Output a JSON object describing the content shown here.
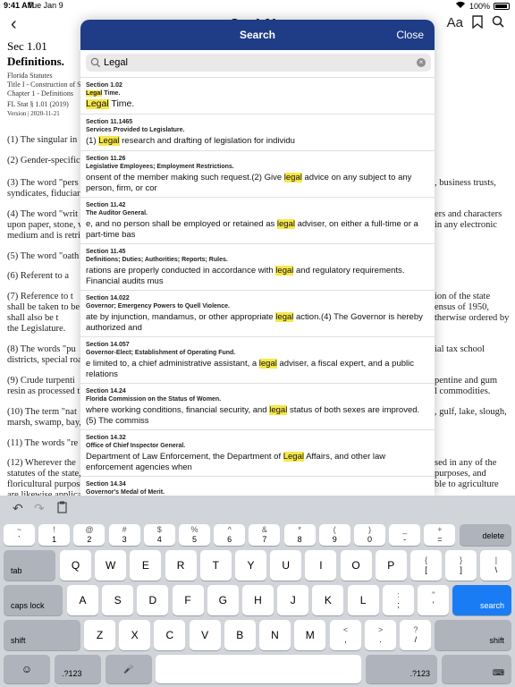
{
  "status": {
    "time": "9:41 AM",
    "date": "Tue Jan 9",
    "battery": "100%"
  },
  "background": {
    "nav_title": "Sec 1.01",
    "section": "Sec 1.01",
    "title": "Definitions.",
    "meta": [
      "Florida Statutes",
      "Title I - Construction of St",
      "Chapter 1 - Definitions",
      "FL Stat § 1.01 (2019)",
      "Version | 2020-11-21"
    ],
    "lines": [
      {
        "l": "(1)   The singular in",
        "r": ""
      },
      {
        "l": "(2)   Gender-specific",
        "r": ""
      },
      {
        "l": "(3)   The word \"pers",
        "r": ", business trusts,"
      },
      {
        "l": "syndicates, fiduciari",
        "r": ""
      },
      {
        "l": "(4)   The word \"writ",
        "r": "ers and characters"
      },
      {
        "l": "upon paper, stone, w",
        "r": "in any electronic"
      },
      {
        "l": "medium and is retrie",
        "r": ""
      },
      {
        "l": "(5)   The word \"oath",
        "r": ""
      },
      {
        "l": "(6)   Referent to a",
        "r": ""
      },
      {
        "l": "(7)   Reference to t",
        "r": "ion of the state"
      },
      {
        "l": "shall be taken to be t",
        "r": "ensus of 1950,"
      },
      {
        "l": "shall also be t",
        "r": "therwise ordered by"
      },
      {
        "l": "the Legislature.",
        "r": ""
      },
      {
        "l": "(8)   The words \"pu",
        "r": "ial tax school"
      },
      {
        "l": "districts, special roa",
        "r": ""
      },
      {
        "l": "(9)   Crude turpenti",
        "r": "pentine and gum"
      },
      {
        "l": "resin as processed th",
        "r": "l commodities."
      },
      {
        "l": "(10)   The term \"nat",
        "r": ", gulf, lake, slough,"
      },
      {
        "l": "marsh, swamp, bay,",
        "r": ""
      },
      {
        "l": "(11)   The words \"re",
        "r": ""
      },
      {
        "l": "(12)   Wherever the",
        "r": "sed in any of the"
      },
      {
        "l": "statutes of the state,",
        "r": "purposes, and"
      },
      {
        "l": "floricultural purpose",
        "r": "ble to agriculture"
      },
      {
        "l": "are likewise applicat",
        "r": ""
      }
    ]
  },
  "search": {
    "title": "Search",
    "close_label": "Close",
    "query": "Legal",
    "results": [
      {
        "section": "Section 1.02",
        "heading_pre": "",
        "heading_hl": "Legal",
        "heading_post": " Time.",
        "pre": "",
        "hl": "Legal",
        "post": " Time."
      },
      {
        "section": "Section 11.1465",
        "heading_pre": "Services Provided to Legislature.",
        "heading_hl": "",
        "heading_post": "",
        "pre": "(1)    ",
        "hl": "Legal",
        "post": " research and drafting of legislation for individu"
      },
      {
        "section": "Section 11.26",
        "heading_pre": "Legislative Employees; Employment Restrictions.",
        "heading_hl": "",
        "heading_post": "",
        "pre": "onsent of the member making such request.(2)    Give ",
        "hl": "legal",
        "post": " advice on any subject to any person, firm, or cor"
      },
      {
        "section": "Section 11.42",
        "heading_pre": "The Auditor General.",
        "heading_hl": "",
        "heading_post": "",
        "pre": "e, and no person shall be employed or retained as ",
        "hl": "legal",
        "post": " adviser, on either a full-time or a part-time bas"
      },
      {
        "section": "Section 11.45",
        "heading_pre": "Definitions; Duties; Authorities; Reports; Rules.",
        "heading_hl": "",
        "heading_post": "",
        "pre": "rations are properly conducted in accordance with ",
        "hl": "legal",
        "post": " and regulatory requirements. Financial audits mus"
      },
      {
        "section": "Section 14.022",
        "heading_pre": "Governor; Emergency Powers to Quell Violence.",
        "heading_hl": "",
        "heading_post": "",
        "pre": "ate by injunction, mandamus, or other appropriate ",
        "hl": "legal",
        "post": " action.(4)    The Governor is hereby authorized and"
      },
      {
        "section": "Section 14.057",
        "heading_pre": "Governor-Elect; Establishment of Operating Fund.",
        "heading_hl": "",
        "heading_post": "",
        "pre": "e limited to, a chief administrative assistant, a ",
        "hl": "legal",
        "post": " adviser, a fiscal expert, and a public relations"
      },
      {
        "section": "Section 14.24",
        "heading_pre": "Florida Commission on the Status of Women.",
        "heading_hl": "",
        "heading_post": "",
        "pre": "where working conditions, financial security, and ",
        "hl": "legal",
        "post": " status of both sexes are improved.(5)    The commiss"
      },
      {
        "section": "Section 14.32",
        "heading_pre": "Office of Chief Inspector General.",
        "heading_hl": "",
        "heading_post": "",
        "pre": " Department of Law Enforcement, the Department of ",
        "hl": "Legal",
        "post": " Affairs, and other law enforcement agencies when"
      },
      {
        "section": "Section 14.34",
        "heading_pre": "Governor's Medal of Merit.",
        "heading_hl": "",
        "heading_post": "",
        "pre": "",
        "hl": "",
        "post": ""
      }
    ]
  },
  "keyboard": {
    "num_row": [
      {
        "top": "~",
        "bot": "`"
      },
      {
        "top": "!",
        "bot": "1"
      },
      {
        "top": "@",
        "bot": "2"
      },
      {
        "top": "#",
        "bot": "3"
      },
      {
        "top": "$",
        "bot": "4"
      },
      {
        "top": "%",
        "bot": "5"
      },
      {
        "top": "^",
        "bot": "6"
      },
      {
        "top": "&",
        "bot": "7"
      },
      {
        "top": "*",
        "bot": "8"
      },
      {
        "top": "(",
        "bot": "9"
      },
      {
        "top": ")",
        "bot": "0"
      },
      {
        "top": "_",
        "bot": "-"
      },
      {
        "top": "+",
        "bot": "="
      }
    ],
    "delete": "delete",
    "tab": "tab",
    "row1": [
      "Q",
      "W",
      "E",
      "R",
      "T",
      "Y",
      "U",
      "I",
      "O",
      "P"
    ],
    "row1_sym": [
      {
        "top": "{",
        "bot": "["
      },
      {
        "top": "}",
        "bot": "]"
      },
      {
        "top": "|",
        "bot": "\\"
      }
    ],
    "caps": "caps lock",
    "row2": [
      "A",
      "S",
      "D",
      "F",
      "G",
      "H",
      "J",
      "K",
      "L"
    ],
    "row2_sym": [
      {
        "top": ":",
        "bot": ";"
      },
      {
        "top": "\"",
        "bot": "'"
      }
    ],
    "search": "search",
    "shift": "shift",
    "row3": [
      "Z",
      "X",
      "C",
      "V",
      "B",
      "N",
      "M"
    ],
    "row3_sym": [
      {
        "top": "<",
        "bot": ","
      },
      {
        "top": ">",
        "bot": "."
      },
      {
        "top": "?",
        "bot": "/"
      }
    ],
    "num_toggle": ".?123",
    "emoji": "☺",
    "mic": "🎤",
    "hide": "⌨"
  },
  "colors": {
    "header": "#1f3d86",
    "highlight": "#f6e74a",
    "accent": "#1a7cf5"
  }
}
